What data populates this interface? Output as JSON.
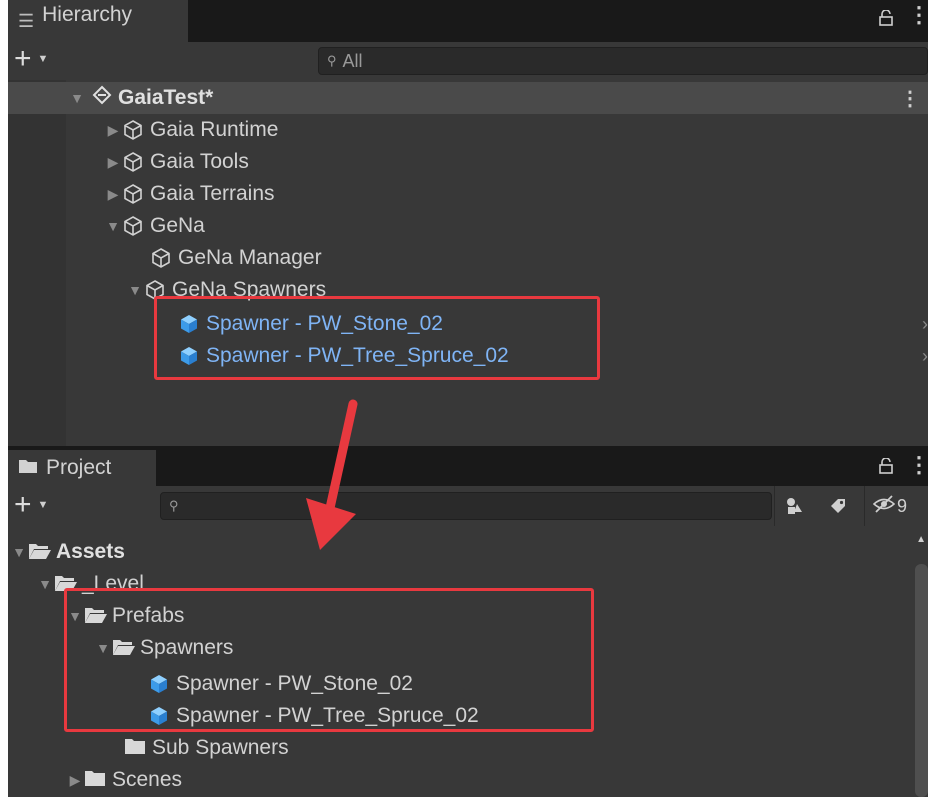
{
  "hierarchy": {
    "tab_label": "Hierarchy",
    "search_placeholder": "All",
    "scene_name": "GaiaTest*",
    "items": [
      {
        "label": "Gaia Runtime"
      },
      {
        "label": "Gaia Tools"
      },
      {
        "label": "Gaia Terrains"
      },
      {
        "label": "GeNa"
      },
      {
        "label": "GeNa Manager"
      },
      {
        "label": "GeNa Spawners"
      },
      {
        "label": "Spawner - PW_Stone_02"
      },
      {
        "label": "Spawner - PW_Tree_Spruce_02"
      }
    ]
  },
  "project": {
    "tab_label": "Project",
    "search_placeholder": "",
    "hidden_count_fragment": "9",
    "items": [
      {
        "label": "Assets"
      },
      {
        "label": "_Level"
      },
      {
        "label": "Prefabs"
      },
      {
        "label": "Spawners"
      },
      {
        "label": "Spawner - PW_Stone_02"
      },
      {
        "label": "Spawner - PW_Tree_Spruce_02"
      },
      {
        "label": "Sub Spawners"
      },
      {
        "label": "Scenes"
      }
    ]
  },
  "colors": {
    "annotation_red": "#e8393f",
    "selected_text_blue": "#7fb4f5",
    "prefab_icon_blue": "#4aa8f0"
  },
  "icons": [
    "hamburger-icon",
    "lock-icon",
    "kebab-menu-icon",
    "plus-icon",
    "search-icon",
    "unity-scene-icon",
    "gameobject-icon",
    "prefab-icon",
    "folder-icon",
    "folder-open-icon",
    "filter-by-type-icon",
    "label-tag-icon",
    "visibility-off-icon",
    "arrow-annotation"
  ]
}
